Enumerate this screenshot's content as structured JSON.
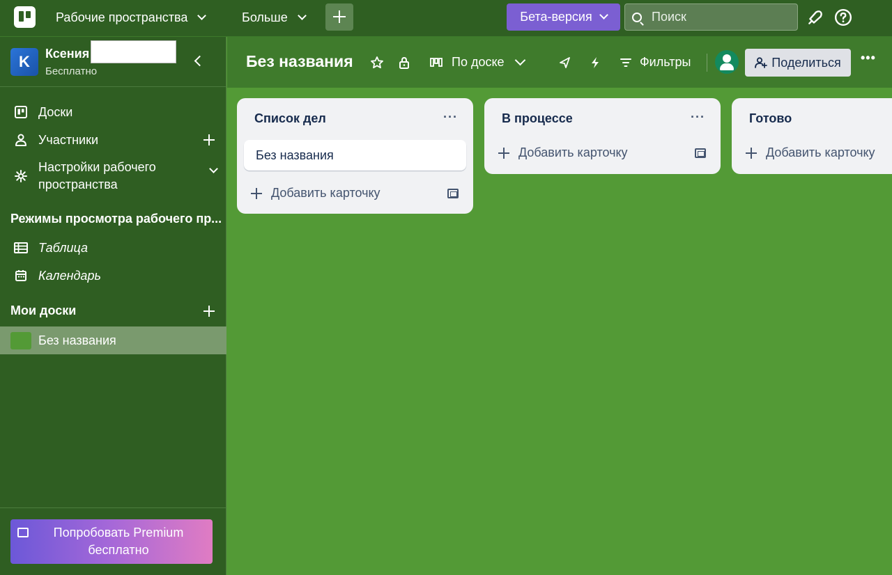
{
  "topbar": {
    "workspaces_label": "Рабочие пространства",
    "more_label": "Больше",
    "beta_label": "Бета-версия",
    "search_placeholder": "Поиск"
  },
  "sidebar": {
    "workspace_initial": "K",
    "workspace_name": "Ксения",
    "workspace_plan": "Бесплатно",
    "nav": {
      "boards": "Доски",
      "members": "Участники",
      "settings": "Настройки рабочего пространства"
    },
    "views_section_title": "Режимы просмотра рабочего пр...",
    "views": {
      "table": "Таблица",
      "calendar": "Календарь"
    },
    "my_boards_title": "Мои доски",
    "boards": [
      {
        "name": "Без названия",
        "color": "#539a36"
      }
    ],
    "premium_label": "Попробовать Premium бесплатно"
  },
  "board": {
    "title": "Без названия",
    "view_label": "По доске",
    "filters_label": "Фильтры",
    "share_label": "Поделиться",
    "background_color": "#539a36"
  },
  "lists": [
    {
      "title": "Список дел",
      "cards": [
        "Без названия"
      ],
      "add_label": "Добавить карточку"
    },
    {
      "title": "В процессе",
      "cards": [],
      "add_label": "Добавить карточку"
    },
    {
      "title": "Готово",
      "cards": [],
      "add_label": "Добавить карточку"
    }
  ],
  "colors": {
    "topbar": "#2f5f22",
    "sidebar": "#2f5e22",
    "beta": "#7b5fd2",
    "list_bg": "#f1f2f4"
  }
}
